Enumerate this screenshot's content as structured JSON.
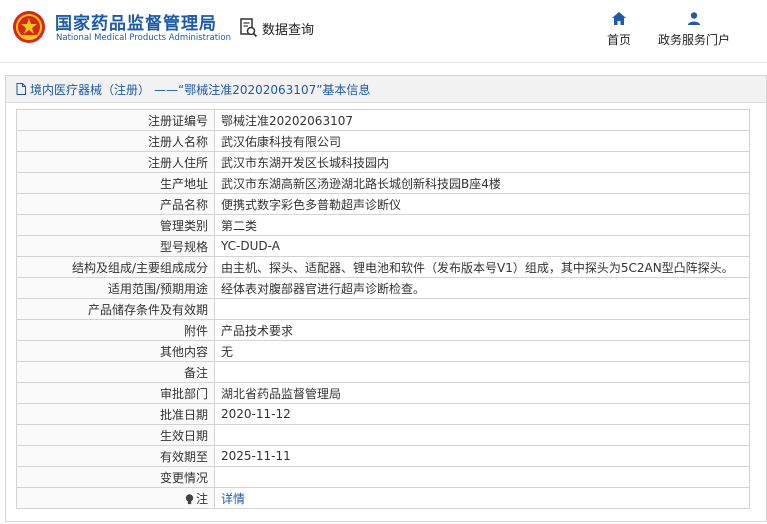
{
  "header": {
    "brand_cn": "国家药品监督管理局",
    "brand_en": "National Medical Products Administration",
    "query_label": "数据查询",
    "nav": [
      {
        "label": "首页",
        "icon": "home-icon"
      },
      {
        "label": "政务服务门户",
        "icon": "user-icon"
      }
    ],
    "brand_color": "#1f5aa6",
    "emblem_color": "#d62718"
  },
  "panel": {
    "title_prefix": "境内医疗器械（注册）",
    "title_rest": "——“鄂械注准20202063107”基本信息"
  },
  "rows": [
    {
      "label": "注册证编号",
      "value": "鄂械注准20202063107"
    },
    {
      "label": "注册人名称",
      "value": "武汉佑康科技有限公司"
    },
    {
      "label": "注册人住所",
      "value": "武汉市东湖开发区长城科技园内"
    },
    {
      "label": "生产地址",
      "value": "武汉市东湖高新区汤逊湖北路长城创新科技园B座4楼"
    },
    {
      "label": "产品名称",
      "value": "便携式数字彩色多普勒超声诊断仪"
    },
    {
      "label": "管理类别",
      "value": "第二类"
    },
    {
      "label": "型号规格",
      "value": "YC-DUD-A"
    },
    {
      "label": "结构及组成/主要组成成分",
      "value": "由主机、探头、适配器、锂电池和软件（发布版本号V1）组成，其中探头为5C2AN型凸阵探头。"
    },
    {
      "label": "适用范围/预期用途",
      "value": "经体表对腹部器官进行超声诊断检查。"
    },
    {
      "label": "产品储存条件及有效期",
      "value": ""
    },
    {
      "label": "附件",
      "value": "产品技术要求"
    },
    {
      "label": "其他内容",
      "value": "无"
    },
    {
      "label": "备注",
      "value": ""
    },
    {
      "label": "审批部门",
      "value": "湖北省药品监督管理局"
    },
    {
      "label": "批准日期",
      "value": "2020-11-12"
    },
    {
      "label": "生效日期",
      "value": ""
    },
    {
      "label": "有效期至",
      "value": "2025-11-11"
    },
    {
      "label": "变更情况",
      "value": ""
    }
  ],
  "note_row": {
    "label": "注",
    "link": "详情",
    "icon": "lightbulb-icon"
  }
}
